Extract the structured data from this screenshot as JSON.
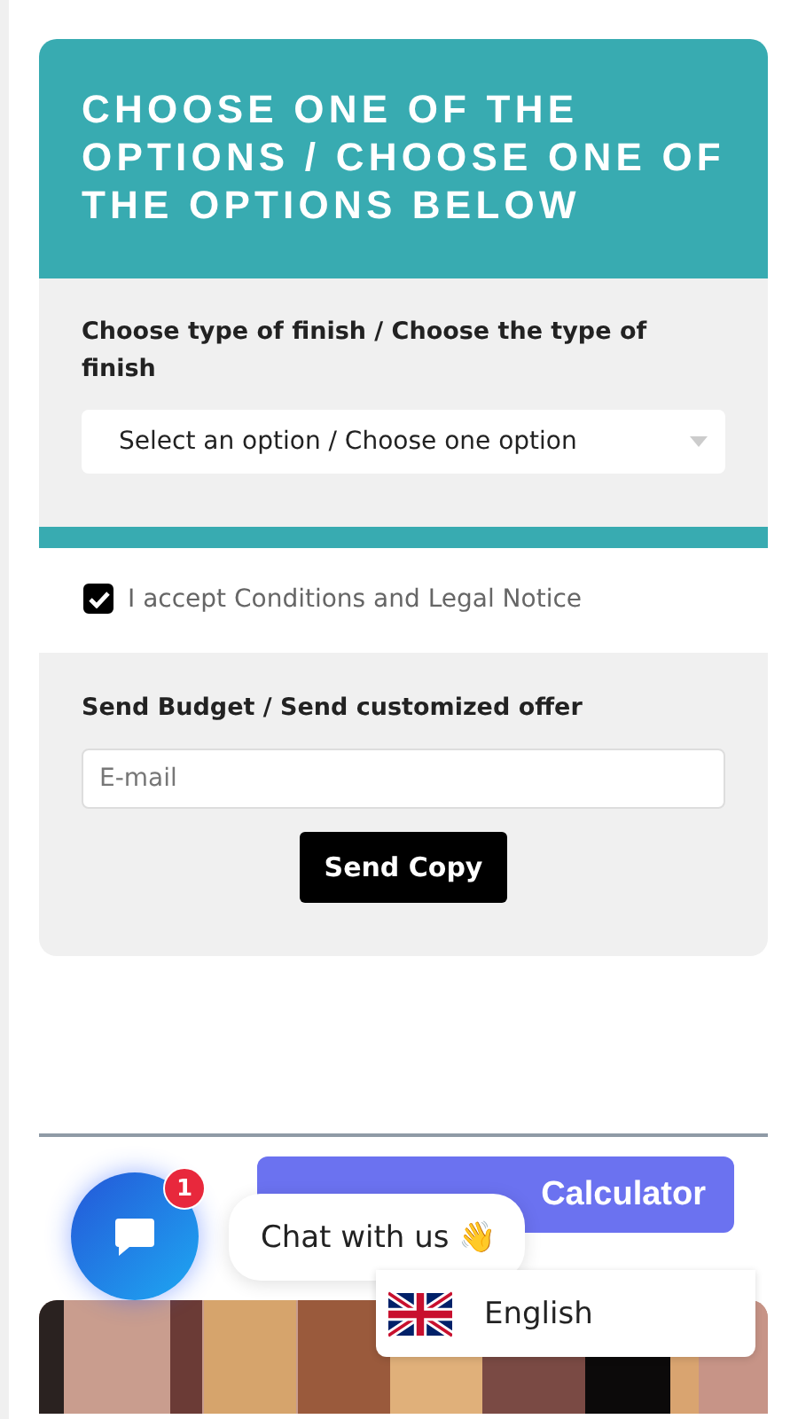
{
  "header": {
    "title": "CHOOSE ONE OF THE OPTIONS / CHOOSE ONE OF THE OPTIONS BELOW"
  },
  "finish": {
    "label": "Choose type of finish / Choose the type of finish",
    "select_value": "Select an option / Choose one option"
  },
  "terms": {
    "label": "I accept Conditions and Legal Notice",
    "checked": true
  },
  "budget": {
    "label": "Send Budget / Send customized offer",
    "email_placeholder": "E-mail",
    "button": "Send Copy"
  },
  "calculator_button": "Calculator",
  "chat": {
    "badge": "1",
    "label": "Chat with us 👋"
  },
  "language": {
    "label": "English"
  }
}
